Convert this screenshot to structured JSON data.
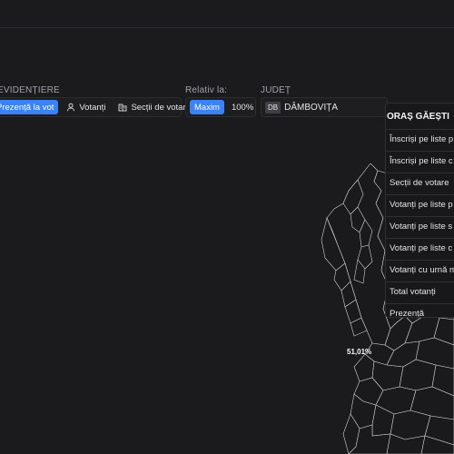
{
  "highlight": {
    "label": "EVIDENȚIERE",
    "options": [
      {
        "label": "Prezență la vot",
        "active": true
      },
      {
        "label": "Votanți",
        "active": false,
        "icon": "user-icon"
      },
      {
        "label": "Secții de votare",
        "active": false,
        "icon": "building-icon"
      }
    ]
  },
  "relative": {
    "label": "Relativ la:",
    "button": "Maxim",
    "value": "100%"
  },
  "county": {
    "label": "JUDEȚ",
    "abbr": "DB",
    "name": "DÂMBOVIȚA"
  },
  "panel": {
    "title": "ORAȘ GĂEȘTI",
    "rows": [
      "Înscriși pe liste p",
      "Înscriși pe liste c",
      "Secții de votare",
      "Votanți pe liste p",
      "Votanți pe liste s",
      "Votanți pe liste c",
      "Votanți cu urnă m",
      "Total votanți",
      "Prezență"
    ]
  },
  "map": {
    "label": "51,01%",
    "colors": {
      "background": "#1b1b1d",
      "region_fill": "#1a1a1c",
      "border": "#d4d4d8",
      "accent": "#3b82f6"
    }
  }
}
